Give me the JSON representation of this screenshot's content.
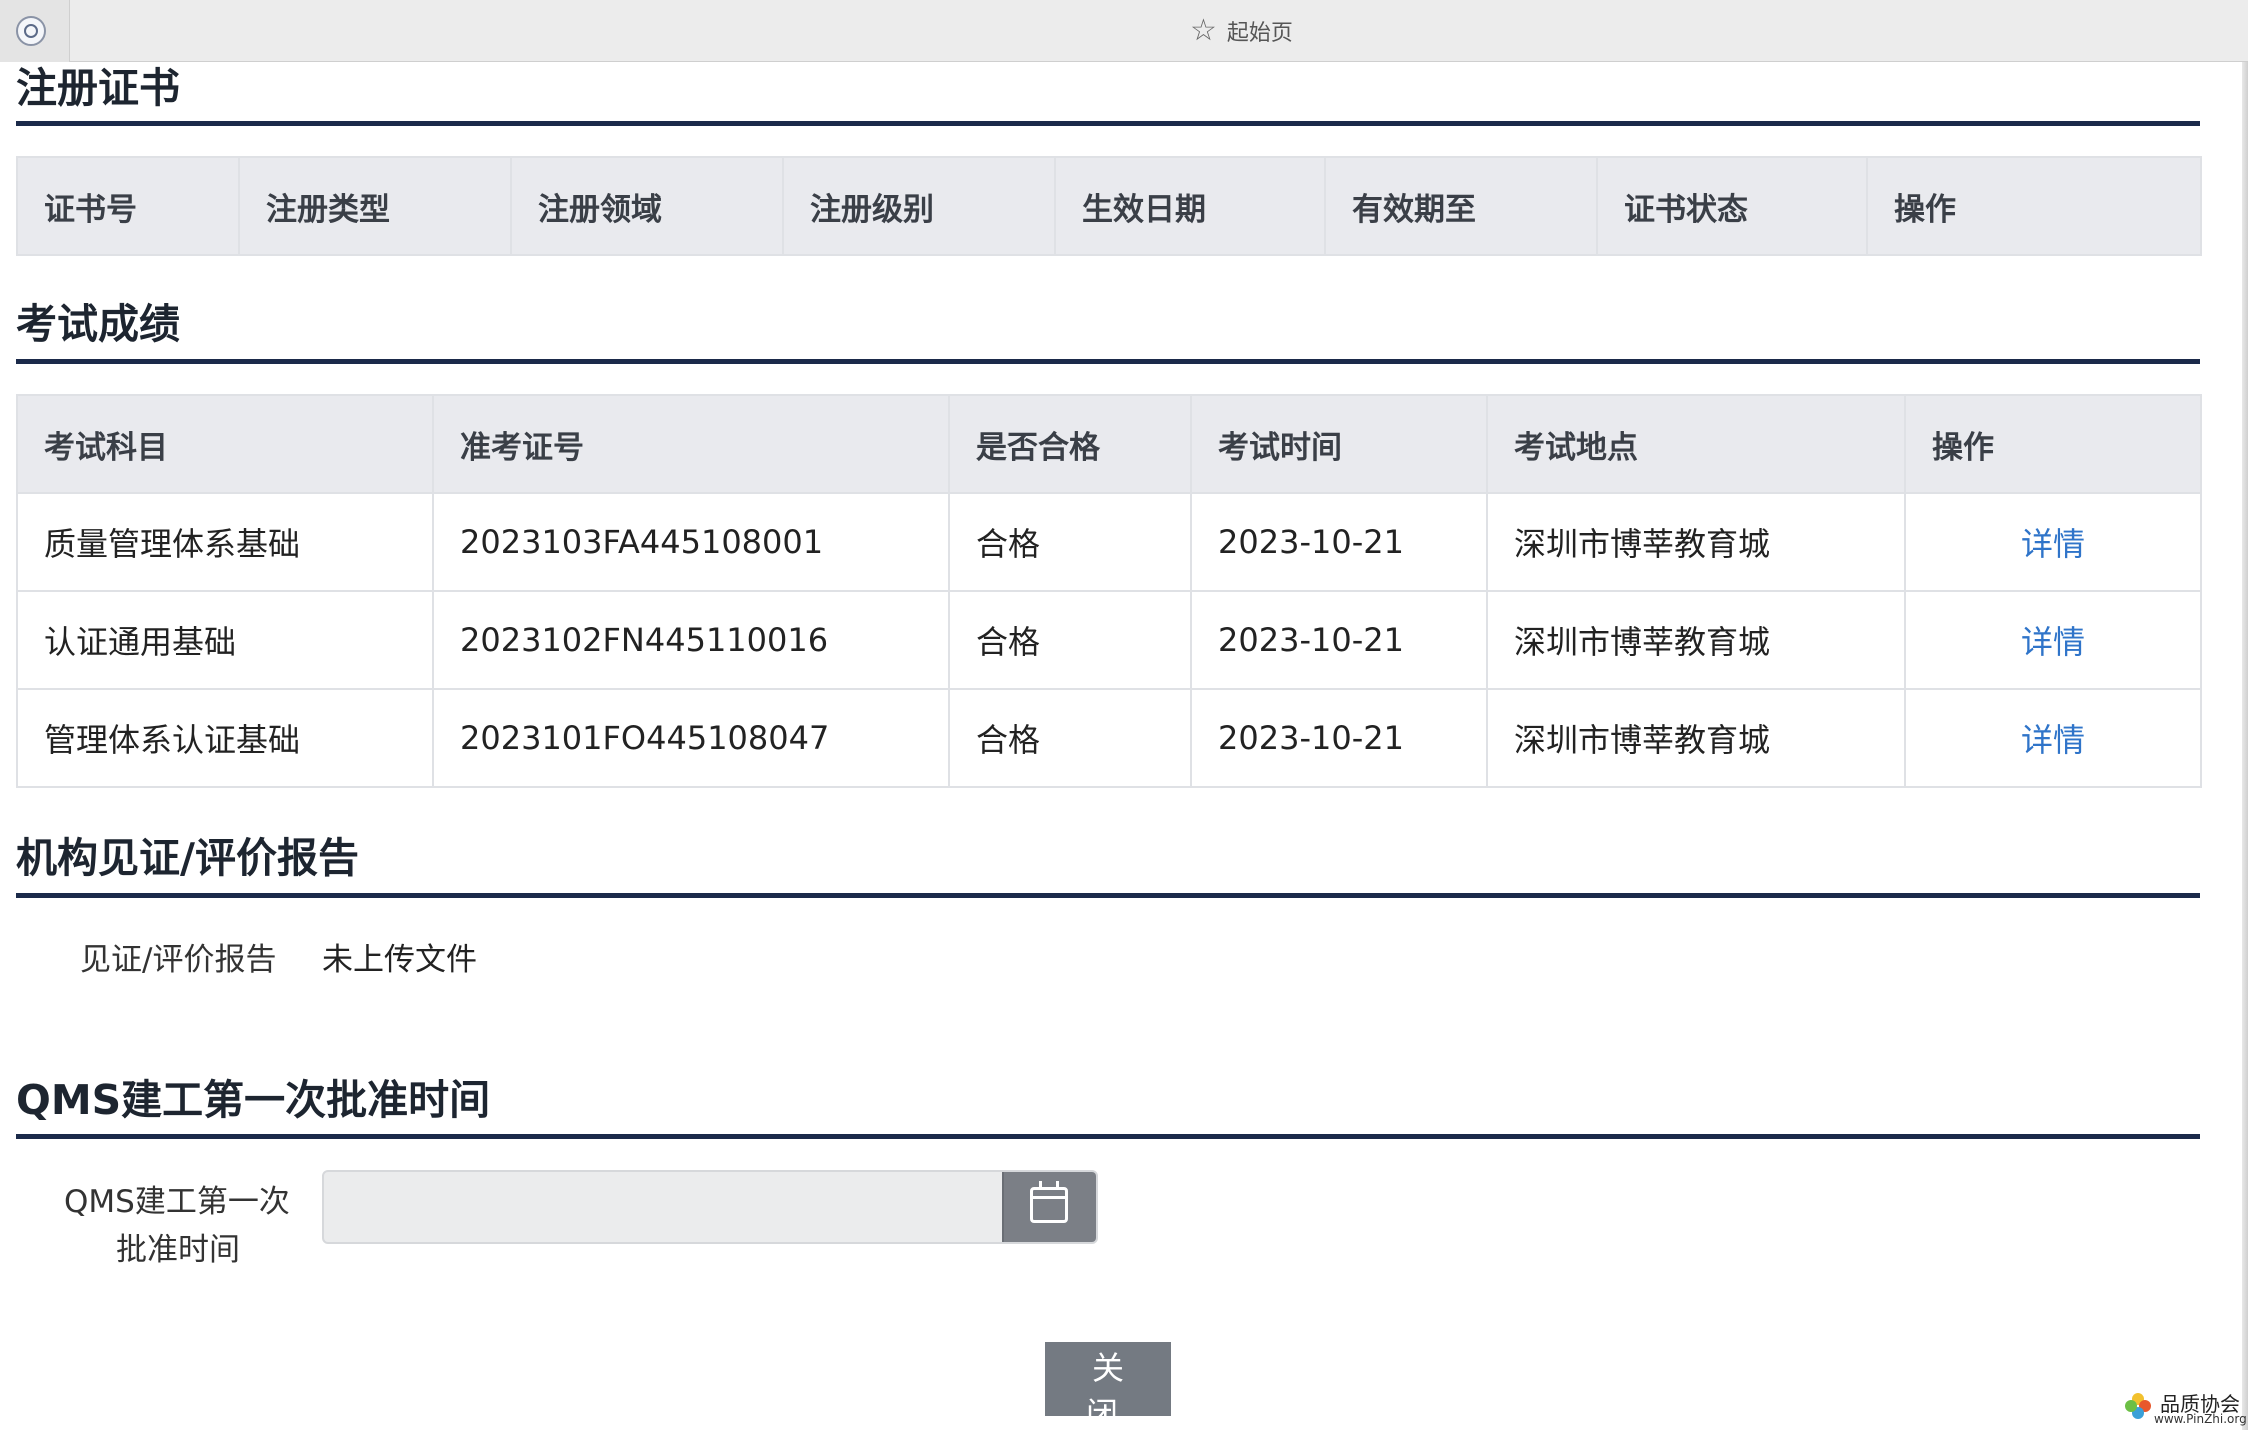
{
  "browser": {
    "tab_title": "起始页",
    "favicon": "ccaa-logo-icon",
    "star_icon": "star-outline-icon"
  },
  "sections": {
    "registration": {
      "title": "注册证书",
      "columns": [
        "证书号",
        "注册类型",
        "注册领域",
        "注册级别",
        "生效日期",
        "有效期至",
        "证书状态",
        "操作"
      ]
    },
    "exam": {
      "title": "考试成绩",
      "columns": [
        "考试科目",
        "准考证号",
        "是否合格",
        "考试时间",
        "考试地点",
        "操作"
      ],
      "rows": [
        {
          "subject": "质量管理体系基础",
          "ticket": "2023103FA445108001",
          "passed": "合格",
          "date": "2023-10-21",
          "location": "深圳市博莘教育城",
          "action": "详情"
        },
        {
          "subject": "认证通用基础",
          "ticket": "2023102FN445110016",
          "passed": "合格",
          "date": "2023-10-21",
          "location": "深圳市博莘教育城",
          "action": "详情"
        },
        {
          "subject": "管理体系认证基础",
          "ticket": "2023101FO445108047",
          "passed": "合格",
          "date": "2023-10-21",
          "location": "深圳市博莘教育城",
          "action": "详情"
        }
      ]
    },
    "report": {
      "title": "机构见证/评价报告",
      "label": "见证/评价报告",
      "value": "未上传文件"
    },
    "qms": {
      "title": "QMS建工第一次批准时间",
      "label_line1": "QMS建工第一次",
      "label_line2": "批准时间",
      "value": "",
      "calendar_icon": "calendar-icon"
    }
  },
  "buttons": {
    "close": "关 闭"
  },
  "watermark": {
    "text": "品质协会",
    "url": "www.PinZhi.org"
  },
  "colors": {
    "rule": "#1b2a4a",
    "link": "#2f74c9",
    "header_bg": "#e9eaee",
    "button_bg": "#747a82"
  }
}
